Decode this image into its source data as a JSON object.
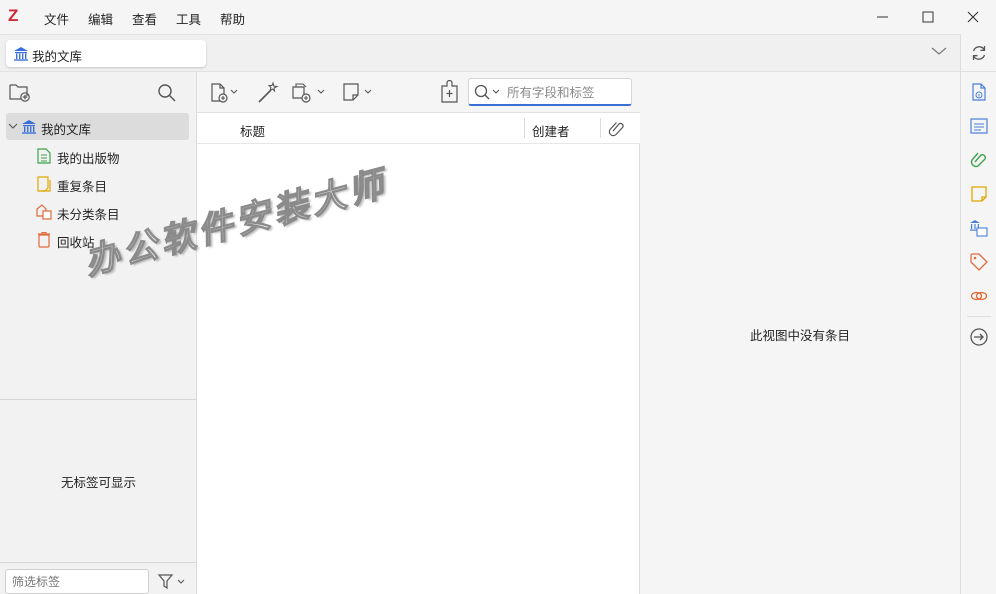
{
  "app": {
    "logo_letter": "Z",
    "brand_color": "#cc2936"
  },
  "menubar": {
    "items": [
      "文件",
      "编辑",
      "查看",
      "工具",
      "帮助"
    ]
  },
  "window_controls": {
    "minimize": "—",
    "maximize": "☐",
    "close": "✕"
  },
  "tabs": {
    "library_tab": "我的文库"
  },
  "collections": {
    "root": "我的文库",
    "items": [
      {
        "label": "我的出版物",
        "icon": "publications-icon",
        "color": "#3fa34d"
      },
      {
        "label": "重复条目",
        "icon": "duplicates-icon",
        "color": "#e0a800"
      },
      {
        "label": "未分类条目",
        "icon": "unfiled-icon",
        "color": "#e06a3a"
      },
      {
        "label": "回收站",
        "icon": "trash-icon",
        "color": "#e06a3a"
      }
    ]
  },
  "tag_selector": {
    "empty_text": "无标签可显示",
    "filter_placeholder": "筛选标签"
  },
  "search": {
    "placeholder": "所有字段和标签"
  },
  "items_table": {
    "columns": [
      "标题",
      "创建者"
    ],
    "attachment_column_icon": "paperclip-icon"
  },
  "item_pane": {
    "empty_text": "此视图中没有条目"
  },
  "watermark": {
    "text": "办公软件安装大师"
  },
  "colors": {
    "accent": "#3a6fd8"
  }
}
